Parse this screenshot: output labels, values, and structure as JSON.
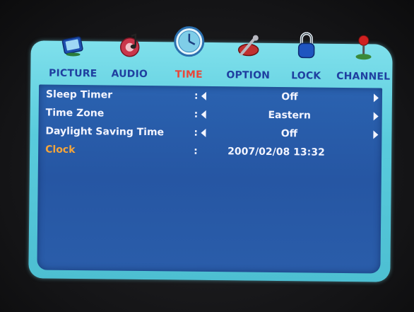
{
  "menu": {
    "tabs": [
      {
        "label": "PICTURE",
        "icon": "tv-icon"
      },
      {
        "label": "AUDIO",
        "icon": "music-icon"
      },
      {
        "label": "TIME",
        "icon": "clock-icon",
        "active": true
      },
      {
        "label": "OPTION",
        "icon": "wrench-icon"
      },
      {
        "label": "LOCK",
        "icon": "padlock-icon"
      },
      {
        "label": "CHANNEL",
        "icon": "joystick-icon"
      }
    ],
    "rows": [
      {
        "name": "Sleep Timer",
        "colon": ":",
        "value": "Off"
      },
      {
        "name": "Time Zone",
        "colon": ":",
        "value": "Eastern"
      },
      {
        "name": "Daylight Saving Time",
        "colon": ":",
        "value": "Off"
      },
      {
        "name": "Clock",
        "colon": ":",
        "value": "2007/02/08 13:32"
      }
    ]
  },
  "colors": {
    "frame": "#59cbdc",
    "panel": "#2656a3",
    "active_tab": "#e8473a",
    "highlight_label": "#f5a53a",
    "tab_label": "#1f3fa0"
  }
}
